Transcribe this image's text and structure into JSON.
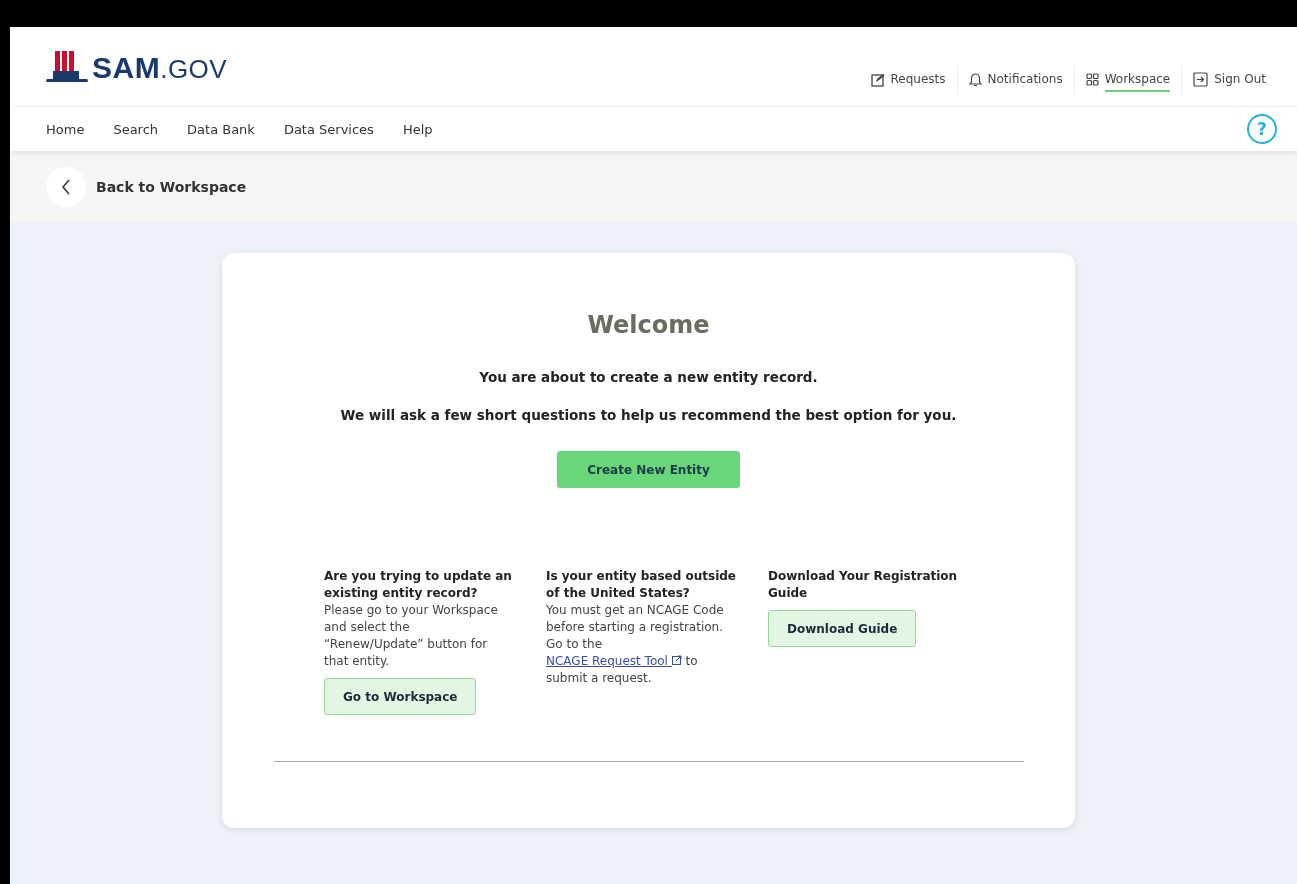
{
  "logo": {
    "name": "SAM",
    "suffix": ".GOV"
  },
  "top_links": [
    {
      "label": "Requests",
      "kind": "edit",
      "selected": false
    },
    {
      "label": "Notifications",
      "kind": "bell",
      "selected": false
    },
    {
      "label": "Workspace",
      "kind": "grid",
      "selected": true
    },
    {
      "label": "Sign Out",
      "kind": "signout",
      "selected": false
    }
  ],
  "help": "?",
  "nav": [
    "Home",
    "Search",
    "Data Bank",
    "Data Services",
    "Help"
  ],
  "back_link": "Back to Workspace",
  "welcome": {
    "title": "Welcome",
    "lines": [
      "You are about to create a new entity record.",
      "We will ask a few short questions to help us recommend the best option for you."
    ],
    "button": "Create New Entity"
  },
  "columns": [
    {
      "heading": "Are you trying to update an existing entity record?",
      "body_before": "Please go to your Workspace and select the “Renew/Update” button for that entity.",
      "button": "Go to Workspace"
    },
    {
      "heading": "Is your entity based outside of the United States?",
      "body_before": "You must get an NCAGE Code before starting a registration. Go to the",
      "link": "NCAGE Request Tool",
      "body_after": "to submit a request."
    },
    {
      "heading": "Download Your Registration Guide",
      "button": "Download Guide"
    }
  ]
}
